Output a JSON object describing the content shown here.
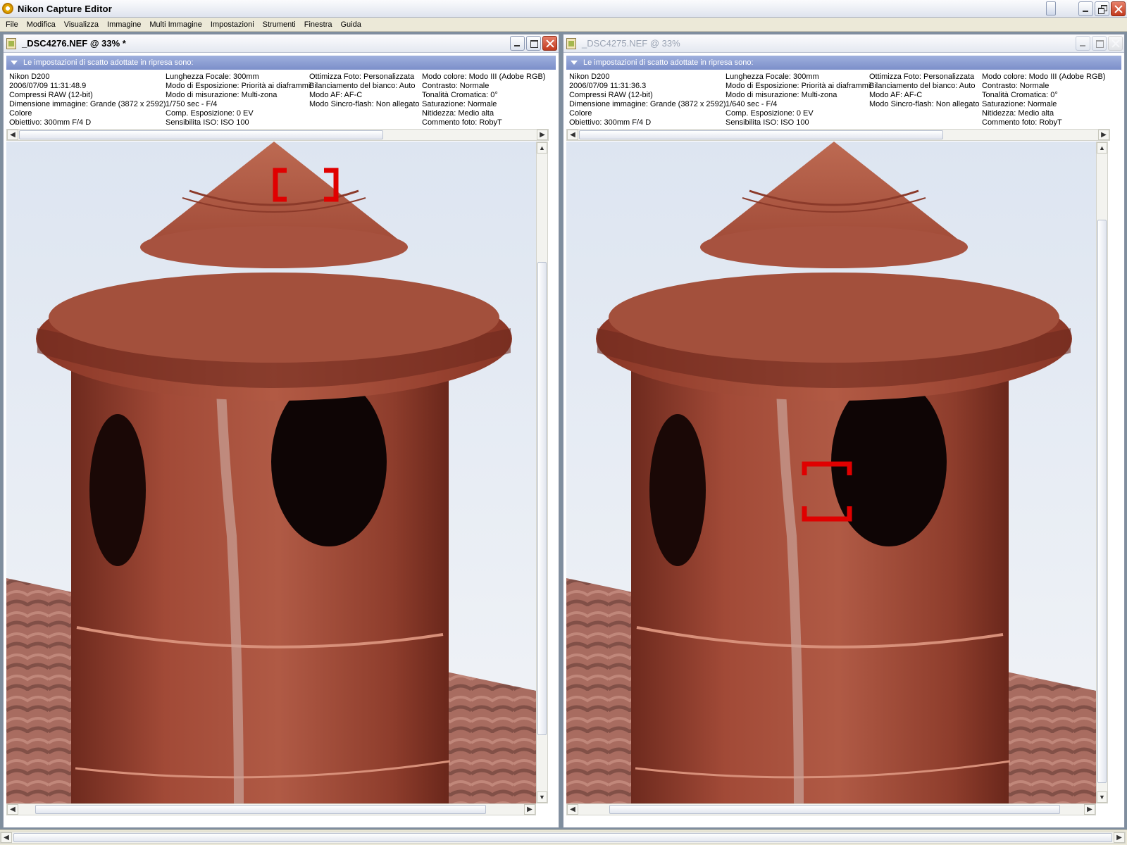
{
  "app": {
    "title": "Nikon Capture Editor"
  },
  "menu": [
    "File",
    "Modifica",
    "Visualizza",
    "Immagine",
    "Multi Immagine",
    "Impostazioni",
    "Strumenti",
    "Finestra",
    "Guida"
  ],
  "windows": [
    {
      "title": "_DSC4276.NEF @ 33% *",
      "active": true,
      "info_header": "Le impostazioni di scatto adottate in ripresa sono:",
      "col1": [
        "Nikon D200",
        "2006/07/09 11:31:48.9",
        "Compressi RAW (12-bit)",
        "Dimensione immagine: Grande (3872 x 2592)",
        "Colore",
        "Obiettivo: 300mm F/4 D"
      ],
      "col2": [
        "Lunghezza Focale: 300mm",
        "Modo di Esposizione: Priorità ai diaframmi",
        "Modo di misurazione: Multi-zona",
        "1/750 sec - F/4",
        "Comp. Esposizione: 0 EV",
        "Sensibilita ISO: ISO 100"
      ],
      "col3": [
        "Ottimizza Foto: Personalizzata",
        "Bilanciamento del bianco: Auto",
        "Modo AF: AF-C",
        "Modo Sincro-flash: Non allegato"
      ],
      "col4": [
        "Modo colore: Modo III (Adobe RGB)",
        "Contrasto: Normale",
        "Tonalità Cromatica: 0°",
        "Saturazione: Normale",
        "Nitidezza: Medio alta",
        "Commento foto: RobyT"
      ]
    },
    {
      "title": "_DSC4275.NEF @ 33%",
      "active": false,
      "info_header": "Le impostazioni di scatto adottate in ripresa sono:",
      "col1": [
        "Nikon D200",
        "2006/07/09 11:31:36.3",
        "Compressi RAW (12-bit)",
        "Dimensione immagine: Grande (3872 x 2592)",
        "Colore",
        "Obiettivo: 300mm F/4 D"
      ],
      "col2": [
        "Lunghezza Focale: 300mm",
        "Modo di Esposizione: Priorità ai diaframmi",
        "Modo di misurazione: Multi-zona",
        "1/640 sec - F/4",
        "Comp. Esposizione: 0 EV",
        "Sensibilita ISO: ISO 100"
      ],
      "col3": [
        "Ottimizza Foto: Personalizzata",
        "Bilanciamento del bianco: Auto",
        "Modo AF: AF-C",
        "Modo Sincro-flash: Non allegato"
      ],
      "col4": [
        "Modo colore: Modo III (Adobe RGB)",
        "Contrasto: Normale",
        "Tonalità Cromatica: 0°",
        "Saturazione: Normale",
        "Nitidezza: Medio alta",
        "Commento foto: RobyT"
      ]
    }
  ],
  "colors": {
    "af_point": "#e00000",
    "info_header": "#8c9dd4",
    "chimney": "#a8503e"
  }
}
